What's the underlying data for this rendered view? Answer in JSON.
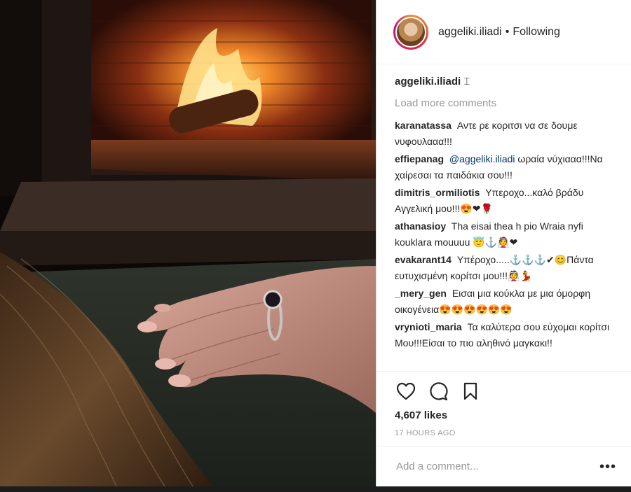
{
  "post": {
    "author": "aggeliki.iliadi",
    "separator": "•",
    "follow_status": "Following",
    "caption_user": "aggeliki.iliadi",
    "caption_text": "⌶"
  },
  "comments_section": {
    "load_more": "Load more comments",
    "items": [
      {
        "user": "karanatassa",
        "text": "Αντε ρε κοριτσι να σε δουμε νυφουλααα!!!"
      },
      {
        "user": "effiepanag",
        "mention": "@aggeliki.iliadi",
        "text": "ωραία νύχιααα!!!Να χαίρεσαι τα παιδάκια σου!!!"
      },
      {
        "user": "dimitris_ormiliotis",
        "text": "Υπεροχο...καλό βράδυ Αγγελική μου!!!😍❤🌹"
      },
      {
        "user": "athanasioy",
        "text": "Tha eisai thea h pio Wraia nyfi kouklara mouuuu 😇⚓👰❤"
      },
      {
        "user": "evakarant14",
        "text": "Υπέροχο.....⚓⚓⚓✔😊Πάντα ευτυχισμένη κορίτσι μου!!!👰💃"
      },
      {
        "user": "_mery_gen",
        "text": "Εισαι μια κούκλα με μια όμορφη οικογένεια😍😍😍😍😍😍"
      },
      {
        "user": "vrynioti_maria",
        "text": "Τα καλύτερα σου εύχομαι κορίτσι Μου!!!Είσαι το πιο αληθινό μαγκακι!!"
      }
    ]
  },
  "actions": {
    "like_icon": "heart-outline-icon",
    "comment_icon": "speech-bubble-icon",
    "save_icon": "bookmark-icon",
    "likes": "4,607 likes",
    "timestamp": "17 HOURS AGO"
  },
  "composer": {
    "placeholder": "Add a comment...",
    "options": "•••"
  },
  "colors": {
    "text": "#262626",
    "muted": "#999999",
    "mention": "#003569",
    "border": "#efefef"
  }
}
